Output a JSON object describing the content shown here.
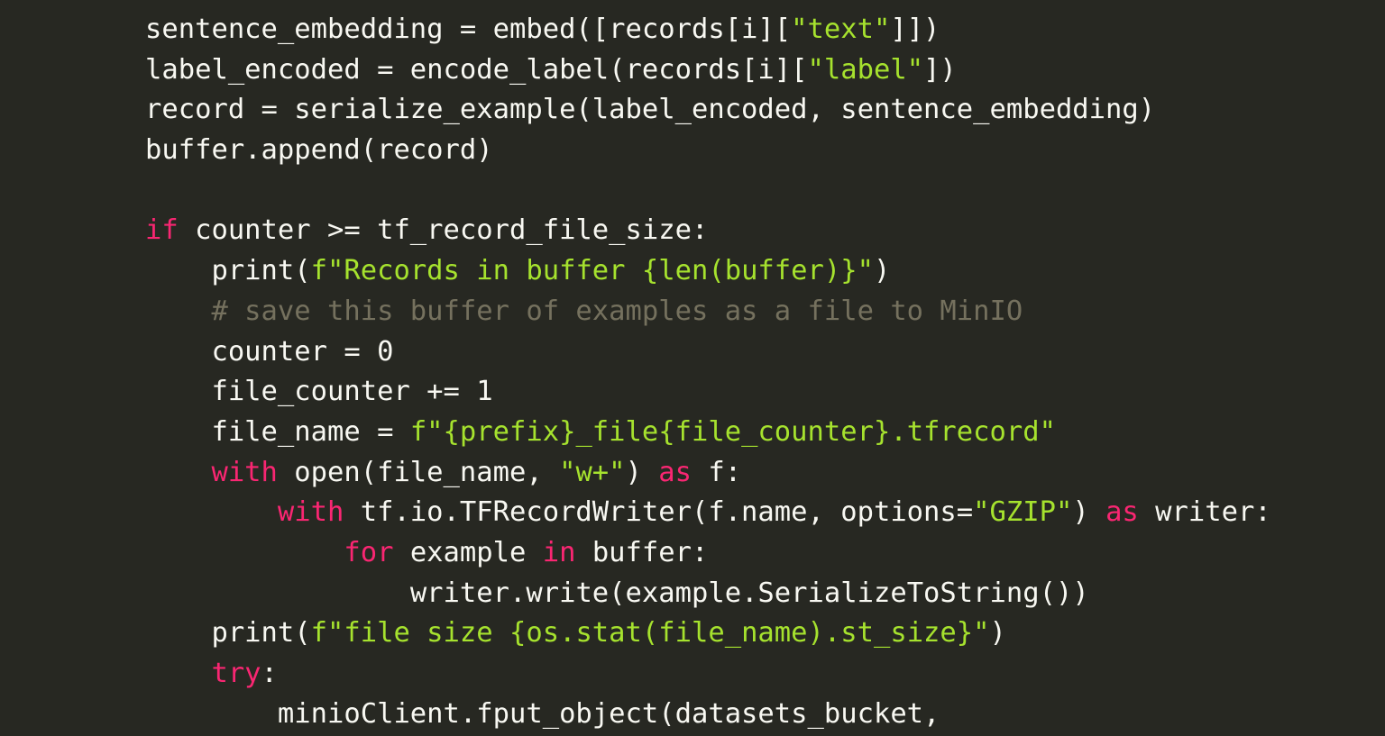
{
  "editor": {
    "colors": {
      "background": "#272822",
      "text": "#F8F8F2",
      "keyword": "#F92672",
      "string": "#A6E22E",
      "comment": "#75715E"
    },
    "lines": [
      {
        "indent": 0,
        "tokens": [
          {
            "t": "txt",
            "v": "sentence_embedding = embed([records[i]["
          },
          {
            "t": "str",
            "v": "\"text\""
          },
          {
            "t": "txt",
            "v": "]])"
          }
        ]
      },
      {
        "indent": 0,
        "tokens": [
          {
            "t": "txt",
            "v": "label_encoded = encode_label(records[i]["
          },
          {
            "t": "str",
            "v": "\"label\""
          },
          {
            "t": "txt",
            "v": "])"
          }
        ]
      },
      {
        "indent": 0,
        "tokens": [
          {
            "t": "txt",
            "v": "record = serialize_example(label_encoded, sentence_embedding)"
          }
        ]
      },
      {
        "indent": 0,
        "tokens": [
          {
            "t": "txt",
            "v": "buffer.append(record)"
          }
        ]
      },
      {
        "indent": 0,
        "tokens": []
      },
      {
        "indent": 0,
        "tokens": [
          {
            "t": "kw",
            "v": "if"
          },
          {
            "t": "txt",
            "v": " counter >= tf_record_file_size:"
          }
        ]
      },
      {
        "indent": 1,
        "tokens": [
          {
            "t": "txt",
            "v": "print("
          },
          {
            "t": "str",
            "v": "f\"Records in buffer {len(buffer)}\""
          },
          {
            "t": "txt",
            "v": ")"
          }
        ]
      },
      {
        "indent": 1,
        "tokens": [
          {
            "t": "cmt",
            "v": "# save this buffer of examples as a file to MinIO"
          }
        ]
      },
      {
        "indent": 1,
        "tokens": [
          {
            "t": "txt",
            "v": "counter = 0"
          }
        ]
      },
      {
        "indent": 1,
        "tokens": [
          {
            "t": "txt",
            "v": "file_counter += 1"
          }
        ]
      },
      {
        "indent": 1,
        "tokens": [
          {
            "t": "txt",
            "v": "file_name = "
          },
          {
            "t": "str",
            "v": "f\"{prefix}_file{file_counter}.tfrecord\""
          }
        ]
      },
      {
        "indent": 1,
        "tokens": [
          {
            "t": "kw",
            "v": "with"
          },
          {
            "t": "txt",
            "v": " open(file_name, "
          },
          {
            "t": "str",
            "v": "\"w+\""
          },
          {
            "t": "txt",
            "v": ") "
          },
          {
            "t": "kw",
            "v": "as"
          },
          {
            "t": "txt",
            "v": " f:"
          }
        ]
      },
      {
        "indent": 2,
        "tokens": [
          {
            "t": "kw",
            "v": "with"
          },
          {
            "t": "txt",
            "v": " tf.io.TFRecordWriter(f.name, options="
          },
          {
            "t": "str",
            "v": "\"GZIP\""
          },
          {
            "t": "txt",
            "v": ") "
          },
          {
            "t": "kw",
            "v": "as"
          },
          {
            "t": "txt",
            "v": " writer:"
          }
        ]
      },
      {
        "indent": 3,
        "tokens": [
          {
            "t": "kw",
            "v": "for"
          },
          {
            "t": "txt",
            "v": " example "
          },
          {
            "t": "kw",
            "v": "in"
          },
          {
            "t": "txt",
            "v": " buffer:"
          }
        ]
      },
      {
        "indent": 4,
        "tokens": [
          {
            "t": "txt",
            "v": "writer.write(example.SerializeToString())"
          }
        ]
      },
      {
        "indent": 1,
        "tokens": [
          {
            "t": "txt",
            "v": "print("
          },
          {
            "t": "str",
            "v": "f\"file size {os.stat(file_name).st_size}\""
          },
          {
            "t": "txt",
            "v": ")"
          }
        ]
      },
      {
        "indent": 1,
        "tokens": [
          {
            "t": "kw",
            "v": "try"
          },
          {
            "t": "txt",
            "v": ":"
          }
        ]
      },
      {
        "indent": 2,
        "tokens": [
          {
            "t": "txt",
            "v": "minioClient.fput_object(datasets_bucket,"
          }
        ]
      }
    ]
  }
}
